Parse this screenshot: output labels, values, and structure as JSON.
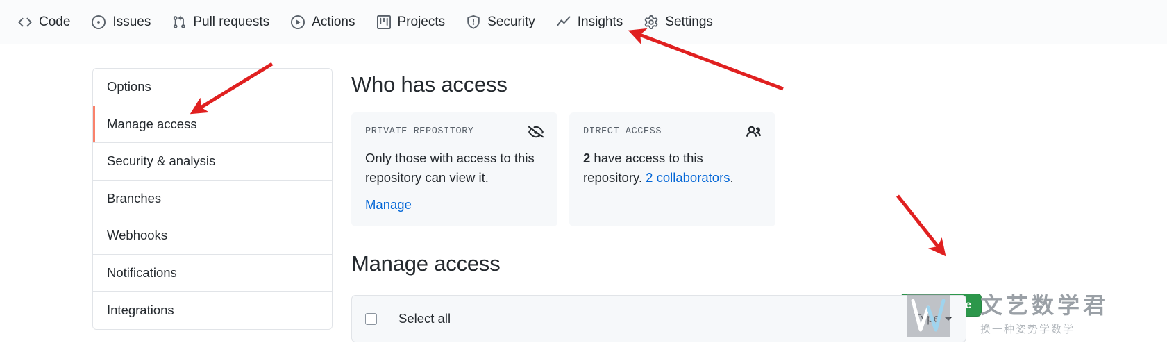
{
  "nav": {
    "items": [
      {
        "label": "Code",
        "icon": "code-icon"
      },
      {
        "label": "Issues",
        "icon": "issue-opened-icon"
      },
      {
        "label": "Pull requests",
        "icon": "git-pull-request-icon"
      },
      {
        "label": "Actions",
        "icon": "play-icon"
      },
      {
        "label": "Projects",
        "icon": "project-icon"
      },
      {
        "label": "Security",
        "icon": "shield-icon"
      },
      {
        "label": "Insights",
        "icon": "graph-icon"
      },
      {
        "label": "Settings",
        "icon": "gear-icon"
      }
    ]
  },
  "sidebar": {
    "items": [
      {
        "label": "Options"
      },
      {
        "label": "Manage access"
      },
      {
        "label": "Security & analysis"
      },
      {
        "label": "Branches"
      },
      {
        "label": "Webhooks"
      },
      {
        "label": "Notifications"
      },
      {
        "label": "Integrations"
      }
    ],
    "active_index": 1
  },
  "main": {
    "who_has_access_title": "Who has access",
    "manage_access_title": "Manage access",
    "cards": [
      {
        "label": "PRIVATE REPOSITORY",
        "icon": "eye-closed-icon",
        "body_text": "Only those with access to this repository can view it.",
        "action_label": "Manage"
      },
      {
        "label": "DIRECT ACCESS",
        "icon": "people-icon",
        "count": "2",
        "body_text": " have access to this repository. ",
        "link_text": "2 collaborators",
        "body_suffix": "."
      }
    ],
    "add_people_label": "Add people",
    "select_all_label": "Select all",
    "type_filter_label": "Type"
  },
  "watermark": {
    "title": "文艺数学君",
    "subtitle": "换一种姿势学数学",
    "logo_letter": "W"
  },
  "colors": {
    "accent_green": "#2c974b",
    "link_blue": "#0366d6",
    "active_border": "#f9826c",
    "arrow_red": "#e02020",
    "nav_bg": "#fafbfc",
    "card_bg": "#f6f8fa",
    "border": "#e1e4e8"
  },
  "annotations": {
    "arrow_to_settings": "Settings",
    "arrow_to_manage_access": "Manage access",
    "arrow_to_add_people": "Add people"
  }
}
